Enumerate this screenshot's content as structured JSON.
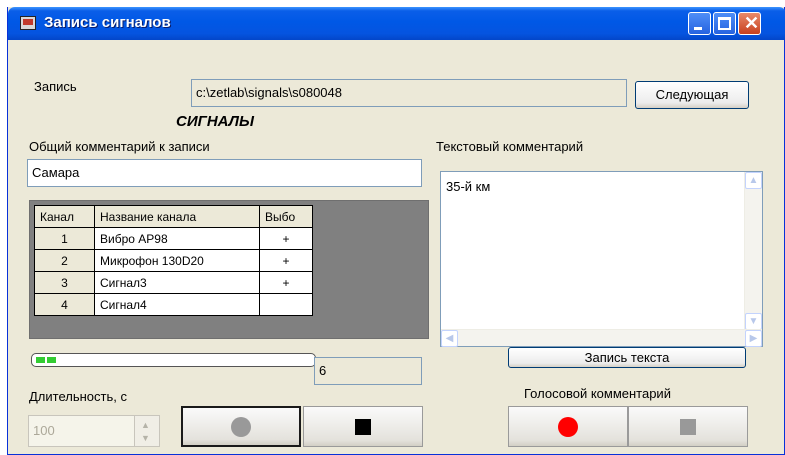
{
  "window": {
    "title": "Запись сигналов"
  },
  "record": {
    "label": "Запись",
    "path": "c:\\zetlab\\signals\\s080048",
    "next_button": "Следующая"
  },
  "signals_heading": "СИГНАЛЫ",
  "general_comment": {
    "label": "Общий комментарий к записи",
    "value": "Самара"
  },
  "channels": {
    "headers": [
      "Канал",
      "Название канала",
      "Выбо"
    ],
    "rows": [
      {
        "num": "1",
        "name": "Вибро АР98",
        "sel": "+"
      },
      {
        "num": "2",
        "name": "Микрофон 130D20",
        "sel": "+"
      },
      {
        "num": "3",
        "name": "Сигнал3",
        "sel": "+"
      },
      {
        "num": "4",
        "name": "Сигнал4",
        "sel": ""
      }
    ]
  },
  "progress": {
    "value_text": "6",
    "filled_fraction": 0.07
  },
  "duration": {
    "label": "Длительность, с",
    "value": "100"
  },
  "text_comment": {
    "label": "Текстовый комментарий",
    "value": "35-й км",
    "save_button": "Запись текста"
  },
  "voice_comment": {
    "label": "Голосовой комментарий"
  },
  "colors": {
    "record_active": "#ff0000",
    "record_inactive": "#999999",
    "stop_active": "#000000",
    "stop_inactive": "#999999"
  },
  "icons": [
    "app-icon",
    "minimize-icon",
    "maximize-icon",
    "close-icon",
    "record-icon",
    "stop-icon"
  ]
}
